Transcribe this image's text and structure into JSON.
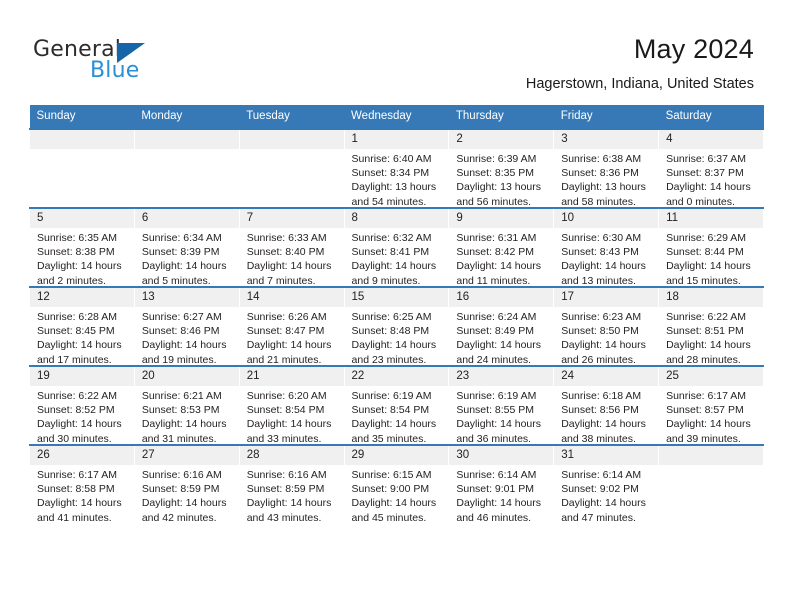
{
  "brand": {
    "name_top": "General",
    "name_bottom": "Blue",
    "accent_color": "#1565a8",
    "accent_light": "#2b8fd6"
  },
  "header": {
    "title": "May 2024",
    "subtitle": "Hagerstown, Indiana, United States"
  },
  "theme": {
    "header_row_bg": "#3679b6",
    "daynum_bg": "#f0f0f0",
    "text_color": "#231f20"
  },
  "calendar": {
    "weekday_headers": [
      "Sunday",
      "Monday",
      "Tuesday",
      "Wednesday",
      "Thursday",
      "Friday",
      "Saturday"
    ],
    "labels": {
      "sunrise": "Sunrise:",
      "sunset": "Sunset:",
      "daylight": "Daylight:"
    },
    "weeks": [
      [
        {
          "day": "",
          "empty": true
        },
        {
          "day": "",
          "empty": true
        },
        {
          "day": "",
          "empty": true
        },
        {
          "day": "1",
          "sunrise": "Sunrise: 6:40 AM",
          "sunset": "Sunset: 8:34 PM",
          "daylight": "Daylight: 13 hours and 54 minutes."
        },
        {
          "day": "2",
          "sunrise": "Sunrise: 6:39 AM",
          "sunset": "Sunset: 8:35 PM",
          "daylight": "Daylight: 13 hours and 56 minutes."
        },
        {
          "day": "3",
          "sunrise": "Sunrise: 6:38 AM",
          "sunset": "Sunset: 8:36 PM",
          "daylight": "Daylight: 13 hours and 58 minutes."
        },
        {
          "day": "4",
          "sunrise": "Sunrise: 6:37 AM",
          "sunset": "Sunset: 8:37 PM",
          "daylight": "Daylight: 14 hours and 0 minutes."
        }
      ],
      [
        {
          "day": "5",
          "sunrise": "Sunrise: 6:35 AM",
          "sunset": "Sunset: 8:38 PM",
          "daylight": "Daylight: 14 hours and 2 minutes."
        },
        {
          "day": "6",
          "sunrise": "Sunrise: 6:34 AM",
          "sunset": "Sunset: 8:39 PM",
          "daylight": "Daylight: 14 hours and 5 minutes."
        },
        {
          "day": "7",
          "sunrise": "Sunrise: 6:33 AM",
          "sunset": "Sunset: 8:40 PM",
          "daylight": "Daylight: 14 hours and 7 minutes."
        },
        {
          "day": "8",
          "sunrise": "Sunrise: 6:32 AM",
          "sunset": "Sunset: 8:41 PM",
          "daylight": "Daylight: 14 hours and 9 minutes."
        },
        {
          "day": "9",
          "sunrise": "Sunrise: 6:31 AM",
          "sunset": "Sunset: 8:42 PM",
          "daylight": "Daylight: 14 hours and 11 minutes."
        },
        {
          "day": "10",
          "sunrise": "Sunrise: 6:30 AM",
          "sunset": "Sunset: 8:43 PM",
          "daylight": "Daylight: 14 hours and 13 minutes."
        },
        {
          "day": "11",
          "sunrise": "Sunrise: 6:29 AM",
          "sunset": "Sunset: 8:44 PM",
          "daylight": "Daylight: 14 hours and 15 minutes."
        }
      ],
      [
        {
          "day": "12",
          "sunrise": "Sunrise: 6:28 AM",
          "sunset": "Sunset: 8:45 PM",
          "daylight": "Daylight: 14 hours and 17 minutes."
        },
        {
          "day": "13",
          "sunrise": "Sunrise: 6:27 AM",
          "sunset": "Sunset: 8:46 PM",
          "daylight": "Daylight: 14 hours and 19 minutes."
        },
        {
          "day": "14",
          "sunrise": "Sunrise: 6:26 AM",
          "sunset": "Sunset: 8:47 PM",
          "daylight": "Daylight: 14 hours and 21 minutes."
        },
        {
          "day": "15",
          "sunrise": "Sunrise: 6:25 AM",
          "sunset": "Sunset: 8:48 PM",
          "daylight": "Daylight: 14 hours and 23 minutes."
        },
        {
          "day": "16",
          "sunrise": "Sunrise: 6:24 AM",
          "sunset": "Sunset: 8:49 PM",
          "daylight": "Daylight: 14 hours and 24 minutes."
        },
        {
          "day": "17",
          "sunrise": "Sunrise: 6:23 AM",
          "sunset": "Sunset: 8:50 PM",
          "daylight": "Daylight: 14 hours and 26 minutes."
        },
        {
          "day": "18",
          "sunrise": "Sunrise: 6:22 AM",
          "sunset": "Sunset: 8:51 PM",
          "daylight": "Daylight: 14 hours and 28 minutes."
        }
      ],
      [
        {
          "day": "19",
          "sunrise": "Sunrise: 6:22 AM",
          "sunset": "Sunset: 8:52 PM",
          "daylight": "Daylight: 14 hours and 30 minutes."
        },
        {
          "day": "20",
          "sunrise": "Sunrise: 6:21 AM",
          "sunset": "Sunset: 8:53 PM",
          "daylight": "Daylight: 14 hours and 31 minutes."
        },
        {
          "day": "21",
          "sunrise": "Sunrise: 6:20 AM",
          "sunset": "Sunset: 8:54 PM",
          "daylight": "Daylight: 14 hours and 33 minutes."
        },
        {
          "day": "22",
          "sunrise": "Sunrise: 6:19 AM",
          "sunset": "Sunset: 8:54 PM",
          "daylight": "Daylight: 14 hours and 35 minutes."
        },
        {
          "day": "23",
          "sunrise": "Sunrise: 6:19 AM",
          "sunset": "Sunset: 8:55 PM",
          "daylight": "Daylight: 14 hours and 36 minutes."
        },
        {
          "day": "24",
          "sunrise": "Sunrise: 6:18 AM",
          "sunset": "Sunset: 8:56 PM",
          "daylight": "Daylight: 14 hours and 38 minutes."
        },
        {
          "day": "25",
          "sunrise": "Sunrise: 6:17 AM",
          "sunset": "Sunset: 8:57 PM",
          "daylight": "Daylight: 14 hours and 39 minutes."
        }
      ],
      [
        {
          "day": "26",
          "sunrise": "Sunrise: 6:17 AM",
          "sunset": "Sunset: 8:58 PM",
          "daylight": "Daylight: 14 hours and 41 minutes."
        },
        {
          "day": "27",
          "sunrise": "Sunrise: 6:16 AM",
          "sunset": "Sunset: 8:59 PM",
          "daylight": "Daylight: 14 hours and 42 minutes."
        },
        {
          "day": "28",
          "sunrise": "Sunrise: 6:16 AM",
          "sunset": "Sunset: 8:59 PM",
          "daylight": "Daylight: 14 hours and 43 minutes."
        },
        {
          "day": "29",
          "sunrise": "Sunrise: 6:15 AM",
          "sunset": "Sunset: 9:00 PM",
          "daylight": "Daylight: 14 hours and 45 minutes."
        },
        {
          "day": "30",
          "sunrise": "Sunrise: 6:14 AM",
          "sunset": "Sunset: 9:01 PM",
          "daylight": "Daylight: 14 hours and 46 minutes."
        },
        {
          "day": "31",
          "sunrise": "Sunrise: 6:14 AM",
          "sunset": "Sunset: 9:02 PM",
          "daylight": "Daylight: 14 hours and 47 minutes."
        },
        {
          "day": "",
          "empty": true
        }
      ]
    ]
  }
}
